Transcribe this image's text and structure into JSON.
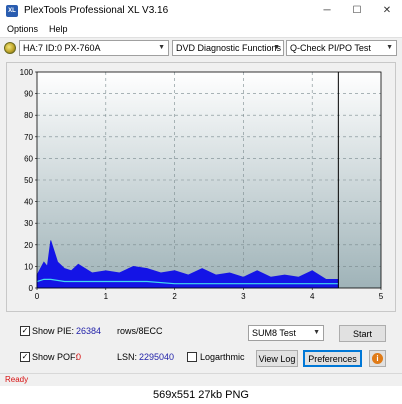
{
  "window": {
    "title": "PlexTools Professional XL V3.16",
    "icon_text": "XL"
  },
  "menu": {
    "items": [
      "Options",
      "Help"
    ]
  },
  "toolbar": {
    "drive": "HA:7 ID:0  PX-760A",
    "function": "DVD Diagnostic Functions",
    "test": "Q-Check PI/PO Test"
  },
  "chart_data": {
    "type": "area",
    "xlabel": "",
    "ylabel": "",
    "xlim": [
      0,
      5
    ],
    "ylim": [
      0,
      100
    ],
    "x_ticks": [
      "0",
      "1",
      "2",
      "3",
      "4",
      "5"
    ],
    "y_ticks": [
      "0",
      "10",
      "20",
      "30",
      "40",
      "50",
      "60",
      "70",
      "80",
      "90",
      "100"
    ],
    "grid": true,
    "end_marker_x": 4.38,
    "series": [
      {
        "color": "#1414e6",
        "x": [
          0.0,
          0.05,
          0.1,
          0.15,
          0.2,
          0.3,
          0.4,
          0.5,
          0.6,
          0.8,
          1.0,
          1.2,
          1.4,
          1.6,
          1.8,
          2.0,
          2.2,
          2.4,
          2.6,
          2.8,
          3.0,
          3.2,
          3.4,
          3.6,
          3.8,
          4.0,
          4.2,
          4.38
        ],
        "y": [
          6,
          9,
          12,
          10,
          22,
          12,
          9,
          8,
          11,
          7,
          8,
          7,
          10,
          9,
          7,
          8,
          6,
          9,
          6,
          7,
          5,
          8,
          5,
          6,
          5,
          8,
          4,
          4
        ]
      },
      {
        "color": "#40d8f0",
        "x": [
          0.0,
          0.1,
          0.2,
          0.4,
          0.8,
          1.2,
          1.6,
          2.0,
          2.4,
          2.8,
          3.2,
          3.6,
          4.0,
          4.38
        ],
        "y": [
          3,
          4,
          4,
          3,
          3,
          3,
          3,
          2,
          2,
          2,
          2,
          2,
          2,
          2
        ]
      }
    ]
  },
  "controls": {
    "show_pie_label": "Show PIE:",
    "pie_value": "26384",
    "pie_unit": "rows/8ECC",
    "test_mode": "SUM8 Test",
    "start_label": "Start",
    "show_pof_label": "Show POF:",
    "pof_value": "0",
    "lsn_label": "LSN:",
    "lsn_value": "2295040",
    "logarithmic_label": "Logarthmic",
    "view_log_label": "View Log",
    "preferences_label": "Preferences",
    "info_glyph": "i"
  },
  "status": {
    "text": "Ready"
  },
  "caption": {
    "text": "569x551 27kb PNG"
  }
}
